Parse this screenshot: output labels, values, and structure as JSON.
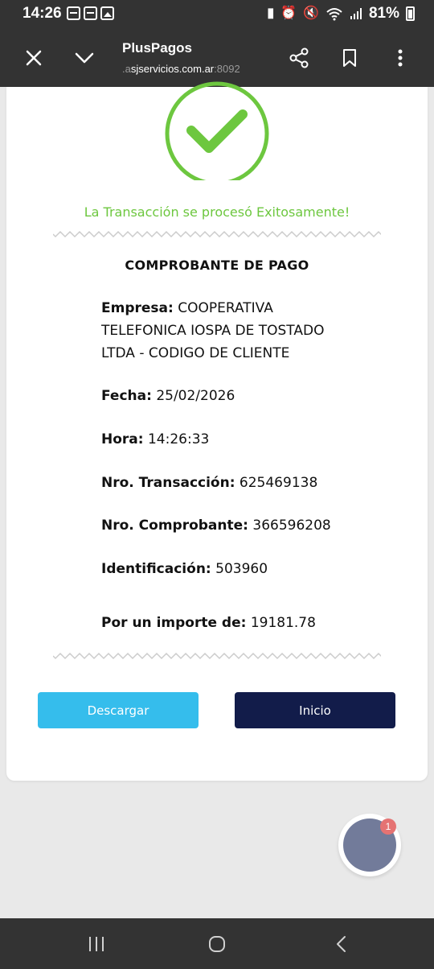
{
  "status_bar": {
    "time": "14:26",
    "battery": "81%",
    "icons": [
      "voicemail-icon",
      "voicemail-icon",
      "image-icon",
      "battery-saver-icon",
      "alarm-icon",
      "mute-icon",
      "wifi-icon",
      "signal-icon",
      "battery-icon"
    ]
  },
  "browser": {
    "title": "PlusPagos",
    "url_prefix": ".a",
    "url_domain": "sjservicios.com.ar",
    "url_port": ":8092"
  },
  "receipt": {
    "success_message": "La Transacción se procesó Exitosamente!",
    "title": "COMPROBANTE DE PAGO",
    "fields": [
      {
        "label": "Empresa:",
        "value": "COOPERATIVA TELEFONICA IOSPA DE TOSTADO LTDA - CODIGO DE CLIENTE"
      },
      {
        "label": "Fecha:",
        "value": "25/02/2026"
      },
      {
        "label": "Hora:",
        "value": "14:26:33"
      },
      {
        "label": "Nro. Transacción:",
        "value": "625469138"
      },
      {
        "label": "Nro. Comprobante:",
        "value": "366596208"
      },
      {
        "label": "Identificación:",
        "value": "503960"
      },
      {
        "label": "Por un importe de:",
        "value": "19181.78"
      }
    ]
  },
  "actions": {
    "download_label": "Descargar",
    "home_label": "Inicio"
  },
  "fab": {
    "badge_count": "1"
  },
  "colors": {
    "success": "#6dc73f",
    "download_button": "#35bdec",
    "home_button": "#121c4a",
    "chrome": "#333333"
  }
}
